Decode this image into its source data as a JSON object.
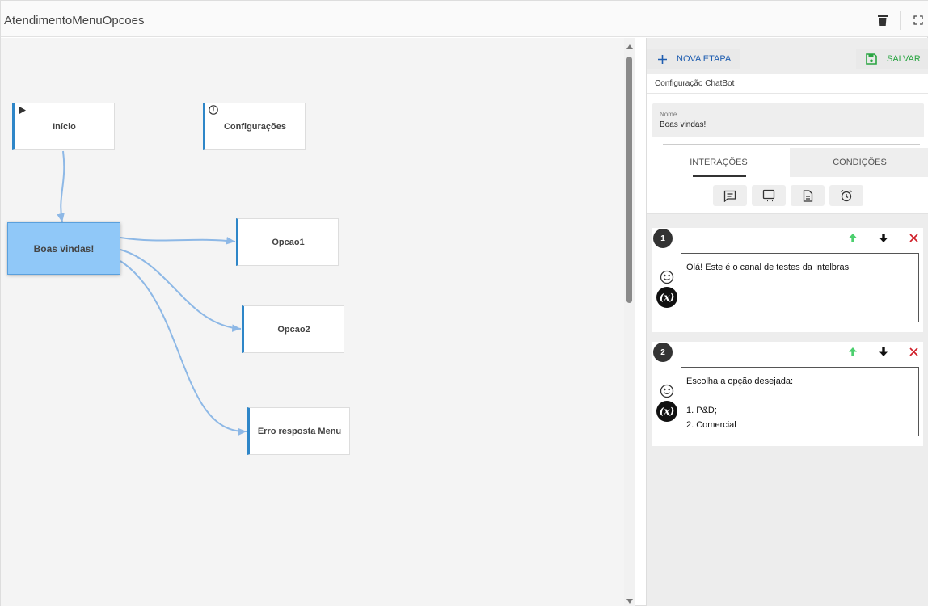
{
  "header": {
    "title": "AtendimentoMenuOpcoes"
  },
  "flow": {
    "nodes": [
      {
        "id": "inicio",
        "label": "Início",
        "icon": "play-icon"
      },
      {
        "id": "config",
        "label": "Configurações",
        "icon": "alert-circle-icon"
      },
      {
        "id": "boas",
        "label": "Boas vindas!",
        "selected": true
      },
      {
        "id": "opcao1",
        "label": "Opcao1"
      },
      {
        "id": "opcao2",
        "label": "Opcao2"
      },
      {
        "id": "erro",
        "label": "Erro resposta Menu"
      }
    ],
    "edges": [
      {
        "from": "inicio",
        "to": "boas"
      },
      {
        "from": "boas",
        "to": "opcao1"
      },
      {
        "from": "boas",
        "to": "opcao2"
      },
      {
        "from": "boas",
        "to": "erro"
      }
    ],
    "colors": {
      "edge": "#8db8e6",
      "node_accent": "#2e86c8",
      "selected_fill": "#90c8f8"
    }
  },
  "toolbar": {
    "new_step_label": "NOVA ETAPA",
    "save_label": "SALVAR"
  },
  "config": {
    "title": "Configuração ChatBot",
    "name_label": "Nome",
    "name_value": "Boas vindas!",
    "tabs": [
      {
        "label": "INTERAÇÕES",
        "active": true
      },
      {
        "label": "CONDIÇÕES",
        "active": false
      }
    ],
    "tools": [
      "message-icon",
      "chat-bubble-icon",
      "document-icon",
      "alarm-icon"
    ]
  },
  "interactions": [
    {
      "number": "1",
      "text": "Olá! Este é o canal de testes da Intelbras"
    },
    {
      "number": "2",
      "text": "Escolha a opção desejada:\n\n1. P&D;\n2. Comercial"
    }
  ],
  "variable_label": "(x)"
}
